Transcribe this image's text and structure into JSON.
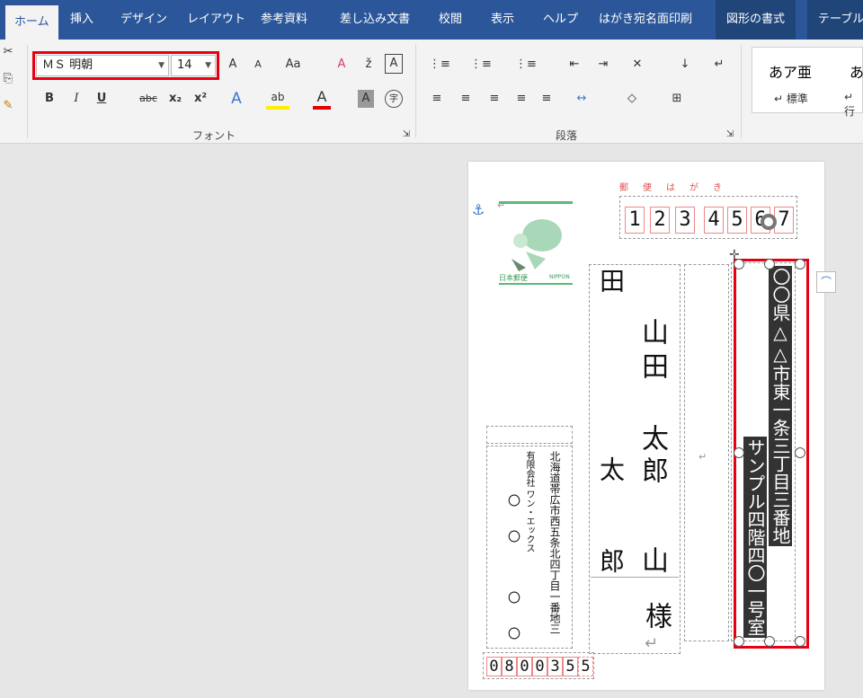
{
  "ribbon_tabs": {
    "home": "ホーム",
    "insert": "挿入",
    "design": "デザイン",
    "layout": "レイアウト",
    "references": "参考資料",
    "mailings": "差し込み文書",
    "review": "校閲",
    "view": "表示",
    "help": "ヘルプ",
    "postcard": "はがき宛名面印刷",
    "shape_format": "図形の書式",
    "table": "テーブル"
  },
  "font": {
    "name": "ＭＳ 明朝",
    "size": "14",
    "group_label": "フォント",
    "grow": "A",
    "shrink": "A",
    "case": "Aa",
    "clear": "A",
    "bold": "B",
    "italic": "I",
    "underline": "U",
    "strike": "abc",
    "sub": "x₂",
    "sup": "x²",
    "effects": "A",
    "highlight": "ab",
    "color": "A",
    "shade": "A",
    "enclose": "字"
  },
  "paragraph": {
    "group_label": "段落"
  },
  "styles": {
    "sample1": "あア亜",
    "sample2": "あ",
    "normal": "↵ 標準",
    "next": "↵ 行"
  },
  "colors": {
    "ribbon_blue": "#2b579a",
    "highlight_red": "#e60012",
    "stamp_green": "#5cb87a",
    "postal_red": "#e88"
  },
  "postcard": {
    "header": "郵　便　は　が　き",
    "postal_digits": [
      "1",
      "2",
      "3",
      "4",
      "5",
      "6",
      "7"
    ],
    "recipient_family1": "田",
    "recipient_family2": "太",
    "recipient_family3": "郎",
    "recipient_name1": "山",
    "recipient_name2": "田",
    "recipient_name3": "太",
    "recipient_name4": "郎",
    "recipient_name5": "山",
    "honorific": "様",
    "address1": "〇〇県△△市東一条三丁目三番地",
    "address2": "サンプル四階四〇一号室",
    "stamp_label": "日本郵便",
    "stamp_label_en": "NIPPON",
    "sender_company": "有限会社 ワン・エックス",
    "sender_address": "北海道帯広市西五条北四丁目一番地三",
    "sender_name1": "〇",
    "sender_name2": "〇",
    "sender_name3": "〇",
    "sender_name4": "〇",
    "sender_postal_digits": [
      "0",
      "8",
      "0",
      "0",
      "3",
      "5",
      "5"
    ]
  }
}
